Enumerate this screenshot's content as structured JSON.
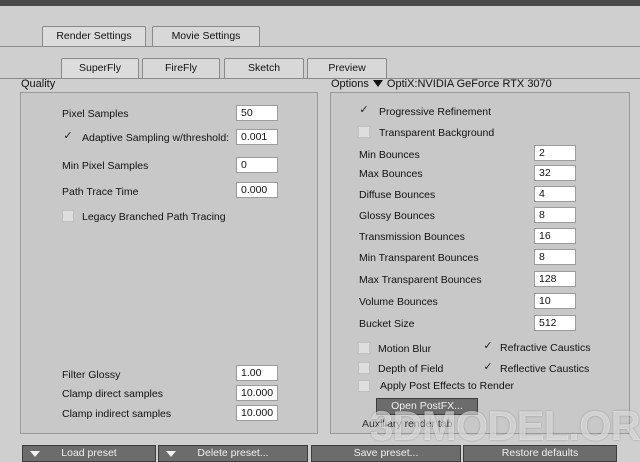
{
  "main_tabs": [
    "Render Settings",
    "Movie Settings"
  ],
  "engine_tabs": [
    "SuperFly",
    "FireFly",
    "Sketch",
    "Preview"
  ],
  "quality": {
    "title": "Quality",
    "pixel_samples": {
      "label": "Pixel Samples",
      "value": "50"
    },
    "adaptive": {
      "label": "Adaptive Sampling w/threshold:",
      "value": "0.001",
      "checked": true
    },
    "min_pixel": {
      "label": "Min Pixel Samples",
      "value": "0"
    },
    "path_trace": {
      "label": "Path Trace Time",
      "value": "0.000"
    },
    "legacy": {
      "label": "Legacy Branched Path Tracing",
      "checked": false
    },
    "filter_glossy": {
      "label": "Filter Glossy",
      "value": "1.00"
    },
    "clamp_direct": {
      "label": "Clamp direct samples",
      "value": "10.000"
    },
    "clamp_indirect": {
      "label": "Clamp indirect samples",
      "value": "10.000"
    }
  },
  "options": {
    "title": "Options",
    "device": "OptiX:NVIDIA GeForce RTX 3070",
    "progressive": {
      "label": "Progressive Refinement",
      "checked": true
    },
    "transparent_bg": {
      "label": "Transparent Background",
      "checked": false
    },
    "bounces": [
      {
        "label": "Min Bounces",
        "value": "2"
      },
      {
        "label": "Max Bounces",
        "value": "32"
      },
      {
        "label": "Diffuse Bounces",
        "value": "4"
      },
      {
        "label": "Glossy Bounces",
        "value": "8"
      },
      {
        "label": "Transmission Bounces",
        "value": "16"
      },
      {
        "label": "Min Transparent Bounces",
        "value": "8"
      },
      {
        "label": "Max Transparent Bounces",
        "value": "128"
      },
      {
        "label": "Volume Bounces",
        "value": "10"
      },
      {
        "label": "Bucket Size",
        "value": "512"
      }
    ],
    "motion_blur": {
      "label": "Motion Blur",
      "checked": false
    },
    "refractive": {
      "label": "Refractive Caustics",
      "checked": true
    },
    "dof": {
      "label": "Depth of Field",
      "checked": false
    },
    "reflective": {
      "label": "Reflective Caustics",
      "checked": true
    },
    "post_effects": {
      "label": "Apply Post Effects to Render",
      "checked": false
    },
    "open_postfx": "Open PostFX...",
    "aux_label": "Auxiliary render tab"
  },
  "bottom_buttons": [
    "Load preset",
    "Delete preset...",
    "Save preset...",
    "Restore defaults"
  ],
  "watermark": "3DMODEL.ORG",
  "check_mark": "✓"
}
